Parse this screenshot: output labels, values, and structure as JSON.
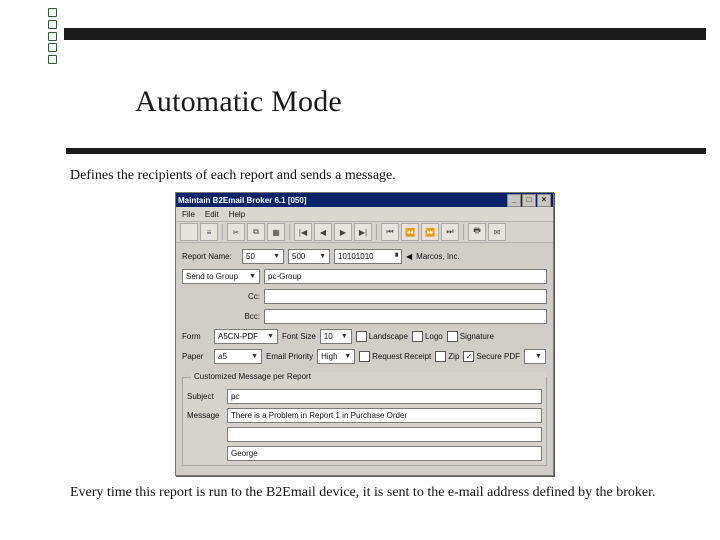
{
  "slide": {
    "title": "Automatic Mode",
    "desc_top": "Defines the recipients of each report and sends a message.",
    "desc_bottom": "Every time this report is run to the B2Email device, it is sent to the e-mail address defined by the broker."
  },
  "window": {
    "title": "Maintain B2Email Broker 6.1 [050]",
    "menu": {
      "file": "File",
      "edit": "Edit",
      "help": "Help"
    },
    "min": "_",
    "max": "□",
    "close": "×",
    "labels": {
      "report_name": "Report Name:",
      "send_to_group": "Send to Group",
      "cc": "Cc:",
      "bcc": "Bcc:",
      "form": "Form",
      "font_size": "Font Size",
      "landscape": "Landscape",
      "logo": "Logo",
      "signature": "Signature",
      "paper": "Paper",
      "email_priority": "Email Priority",
      "request_receipt": "Request Receipt",
      "zip": "Zip",
      "secure_pdf": "Secure PDF",
      "customized": "Customized Message per Report",
      "subject": "Subject",
      "message": "Message"
    },
    "values": {
      "report_code": "50",
      "report_batch": "500",
      "report_num": "10101010",
      "report_customer": "Marcos, Inc.",
      "send_group": "pc-Group",
      "form_value": "A5CN-PDF",
      "font_size_value": "10",
      "paper_value": "a5",
      "priority_value": "High",
      "subject_value": "pc",
      "body_line1": "There is a Problem in Report 1 in Purchase Order",
      "body_line2": "",
      "body_line3": "George"
    }
  }
}
